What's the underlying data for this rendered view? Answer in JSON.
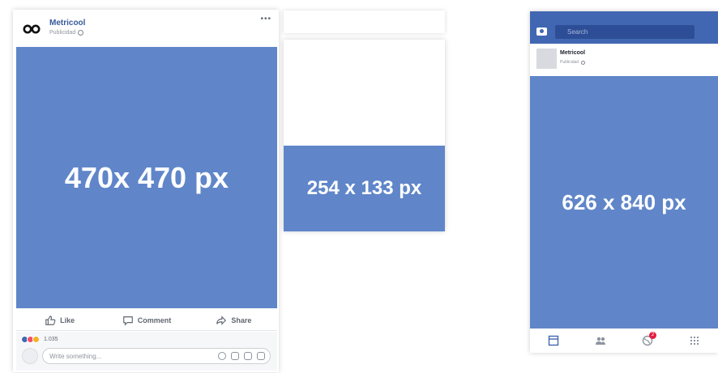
{
  "colors": {
    "facebook_blue": "#4267b2",
    "media_blue": "#6086c9",
    "badge_red": "#e41e3f"
  },
  "left_post": {
    "page_name": "Metricool",
    "sponsored": "Publicidad",
    "more_icon": "more-icon",
    "image_label": "470x 470 px",
    "actions": {
      "like": "Like",
      "comment": "Comment",
      "share": "Share"
    },
    "reaction_count": "1.035",
    "comment_placeholder": "Write something..."
  },
  "middle_card": {
    "image_label": "254 x 133 px"
  },
  "mobile": {
    "search_placeholder": "Search",
    "page_name": "Metricool",
    "sponsored": "Publicidad",
    "image_label": "626 x 840 px",
    "notification_count": "2"
  }
}
